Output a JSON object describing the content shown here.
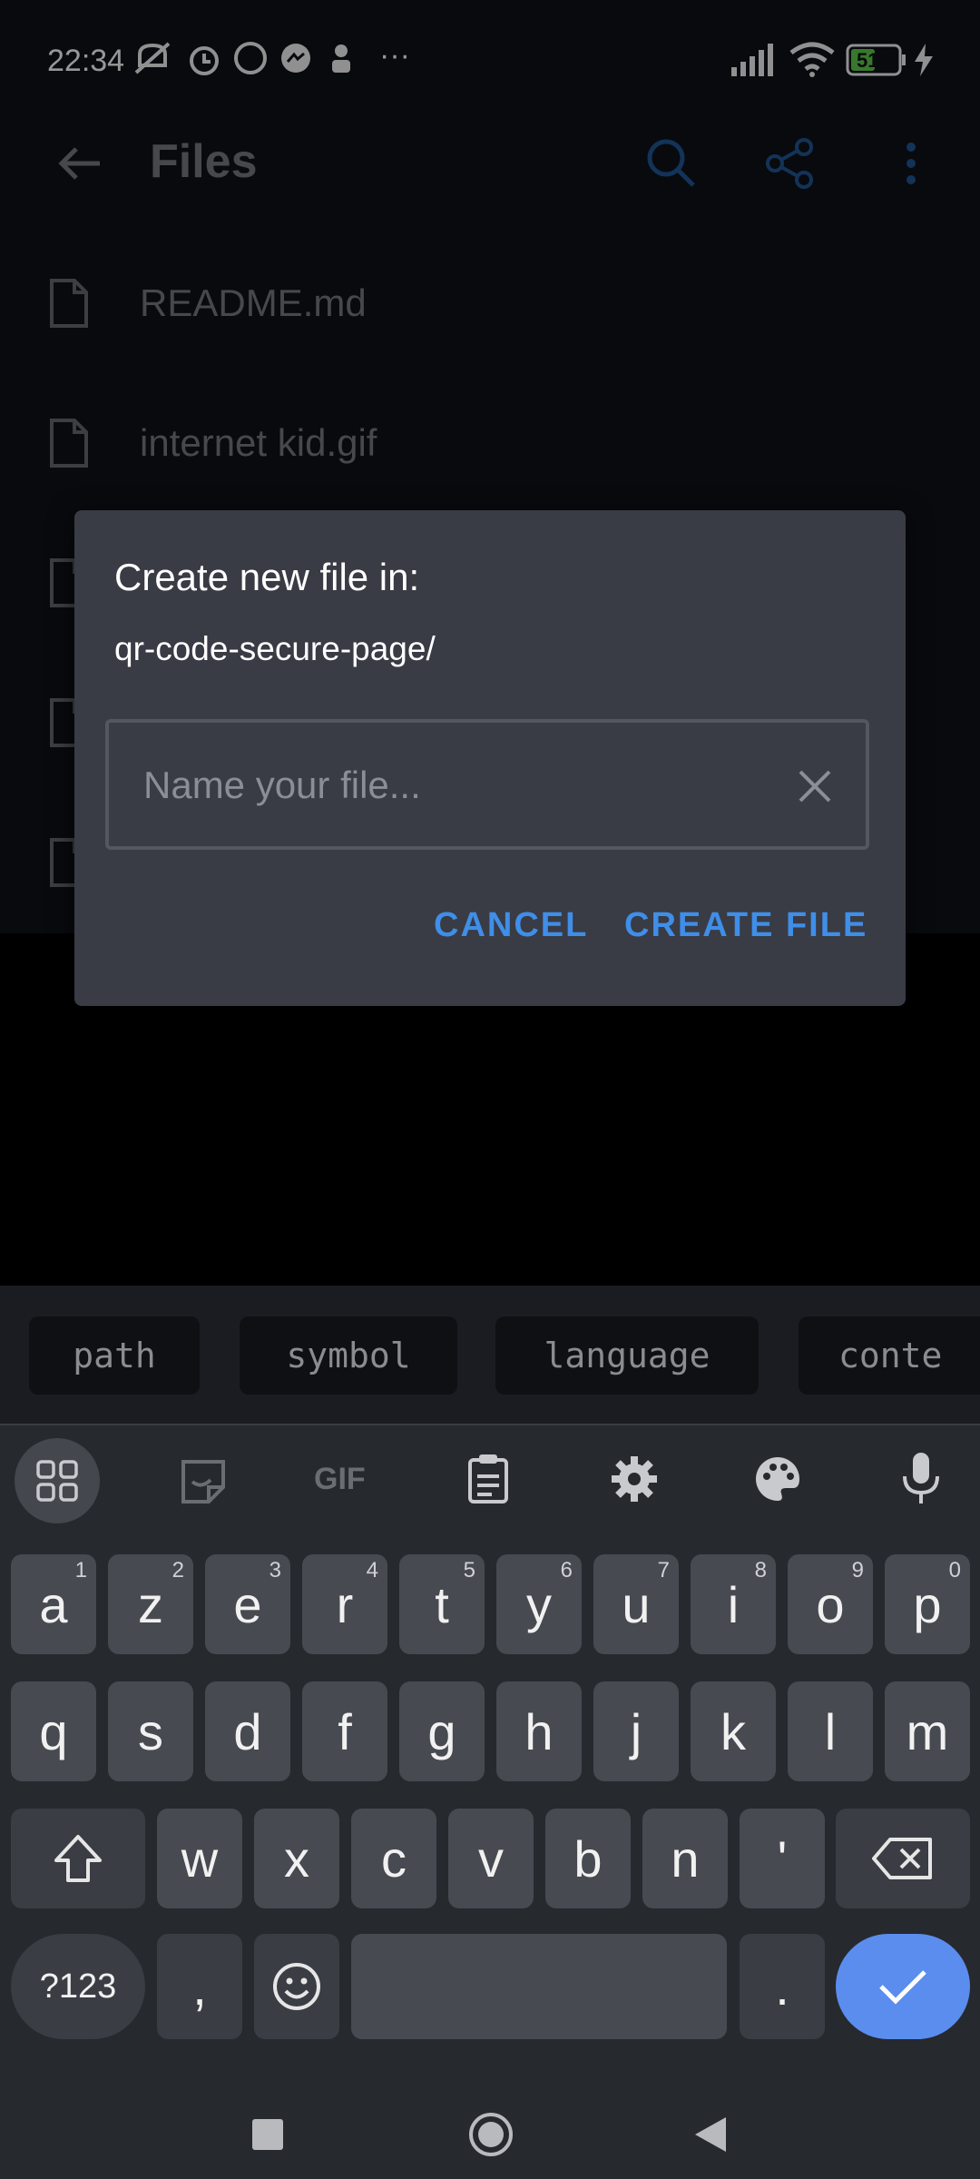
{
  "status_bar": {
    "time": "22:34",
    "battery": "51",
    "more": "···",
    "icons": [
      "mute-icon",
      "alarm-icon",
      "whatsapp-icon",
      "messenger-icon",
      "app-notification-icon",
      "signal-icon",
      "wifi-icon",
      "battery-icon",
      "charging-icon"
    ]
  },
  "app_bar": {
    "title": "Files",
    "icons": [
      "back-arrow-icon",
      "search-icon",
      "share-icon",
      "more-vert-icon"
    ]
  },
  "files": [
    {
      "name": "README.md"
    },
    {
      "name": "internet kid.gif"
    },
    {
      "name": ""
    },
    {
      "name": ""
    },
    {
      "name": ""
    }
  ],
  "dialog": {
    "title": "Create new file in:",
    "path": "qr-code-secure-page/",
    "input_placeholder": "Name your file...",
    "input_value": "",
    "cancel_label": "CANCEL",
    "create_label": "CREATE FILE"
  },
  "suggestions": [
    "path",
    "symbol",
    "language",
    "conte"
  ],
  "keyboard": {
    "toolbar_icons": [
      "apps-grid-icon",
      "sticker-icon",
      "gif-icon",
      "clipboard-icon",
      "settings-icon",
      "palette-icon",
      "microphone-icon"
    ],
    "gif_label": "GIF",
    "row1": [
      {
        "k": "a",
        "h": "1"
      },
      {
        "k": "z",
        "h": "2"
      },
      {
        "k": "e",
        "h": "3"
      },
      {
        "k": "r",
        "h": "4"
      },
      {
        "k": "t",
        "h": "5"
      },
      {
        "k": "y",
        "h": "6"
      },
      {
        "k": "u",
        "h": "7"
      },
      {
        "k": "i",
        "h": "8"
      },
      {
        "k": "o",
        "h": "9"
      },
      {
        "k": "p",
        "h": "0"
      }
    ],
    "row2": [
      "q",
      "s",
      "d",
      "f",
      "g",
      "h",
      "j",
      "k",
      "l",
      "m"
    ],
    "row3": [
      "w",
      "x",
      "c",
      "v",
      "b",
      "n",
      "'"
    ],
    "symbols_label": "?123",
    "comma": ",",
    "period": ".",
    "accent_color": "#5b8def"
  },
  "nav_bar": {
    "icons": [
      "recents-square-icon",
      "home-circle-icon",
      "back-triangle-icon"
    ]
  }
}
